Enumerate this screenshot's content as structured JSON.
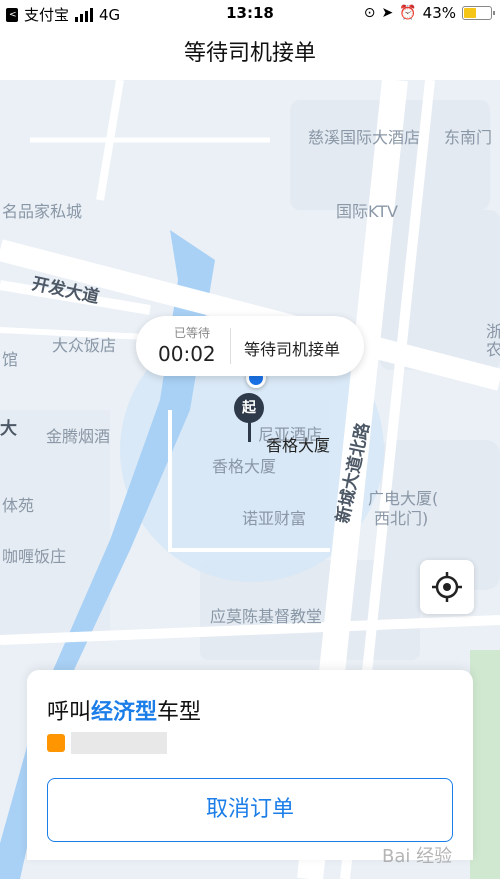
{
  "status_bar": {
    "back_app": "支付宝",
    "network": "4G",
    "time": "13:18",
    "battery": "43%"
  },
  "header": {
    "title": "等待司机接单"
  },
  "map": {
    "labels": [
      {
        "text": "慈溪国际大酒店"
      },
      {
        "text": "东南门"
      },
      {
        "text": "名品家私城"
      },
      {
        "text": "国际KTV"
      },
      {
        "text": "大众饭店"
      },
      {
        "text": "馆"
      },
      {
        "text": "金腾烟酒"
      },
      {
        "text": "尼亚酒店"
      },
      {
        "text": "香格大厦"
      },
      {
        "text": "诺亚财富"
      },
      {
        "text": "广电大厦("
      },
      {
        "text": "西北门)"
      },
      {
        "text": "体苑"
      },
      {
        "text": "咖喱饭庄"
      },
      {
        "text": "应莫陈基督教堂"
      },
      {
        "text": "浙"
      },
      {
        "text": "农"
      }
    ],
    "road_labels": [
      {
        "text": "开发大道"
      },
      {
        "text": "新城大道北路"
      },
      {
        "text": "大"
      }
    ]
  },
  "wait_bubble": {
    "timer_label": "已等待",
    "timer": "00:02",
    "status": "等待司机接单"
  },
  "start_pin": {
    "pin": "起",
    "label": "香格大厦"
  },
  "card": {
    "title_prefix": "呼叫",
    "title_highlight": "经济型",
    "title_suffix": "车型",
    "cancel_button": "取消订单"
  },
  "watermark": "Bai 经验",
  "colors": {
    "accent": "#1b7ee8",
    "pin": "#2e3a4a",
    "badge": "#ff9500"
  }
}
